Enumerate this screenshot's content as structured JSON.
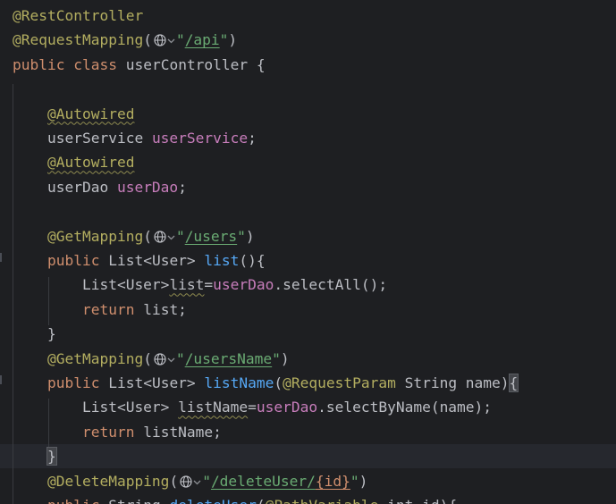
{
  "editor": {
    "lines": [
      {
        "tokens": [
          {
            "t": "@RestController",
            "c": "ann"
          }
        ]
      },
      {
        "tokens": [
          {
            "t": "@RequestMapping",
            "c": "ann"
          },
          {
            "t": "(",
            "c": ""
          },
          {
            "icon": "globe"
          },
          {
            "t": "\"",
            "c": "str"
          },
          {
            "t": "/api",
            "c": "str url"
          },
          {
            "t": "\"",
            "c": "str"
          },
          {
            "t": ")",
            "c": ""
          }
        ]
      },
      {
        "tokens": [
          {
            "t": "public ",
            "c": "kw"
          },
          {
            "t": "class ",
            "c": "kw"
          },
          {
            "t": "userController {",
            "c": ""
          }
        ]
      },
      {
        "tokens": []
      },
      {
        "tokens": [
          {
            "t": "    ",
            "c": ""
          },
          {
            "t": "@Autowired",
            "c": "ann sq"
          }
        ]
      },
      {
        "tokens": [
          {
            "t": "    userService ",
            "c": ""
          },
          {
            "t": "userService",
            "c": "field"
          },
          {
            "t": ";",
            "c": ""
          }
        ]
      },
      {
        "tokens": [
          {
            "t": "    ",
            "c": ""
          },
          {
            "t": "@Autowired",
            "c": "ann sq"
          }
        ]
      },
      {
        "tokens": [
          {
            "t": "    userDao ",
            "c": ""
          },
          {
            "t": "userDao",
            "c": "field"
          },
          {
            "t": ";",
            "c": ""
          }
        ]
      },
      {
        "tokens": []
      },
      {
        "tokens": [
          {
            "t": "    ",
            "c": ""
          },
          {
            "t": "@GetMapping",
            "c": "ann"
          },
          {
            "t": "(",
            "c": ""
          },
          {
            "icon": "globe"
          },
          {
            "t": "\"",
            "c": "str"
          },
          {
            "t": "/users",
            "c": "str url"
          },
          {
            "t": "\"",
            "c": "str"
          },
          {
            "t": ")",
            "c": ""
          }
        ]
      },
      {
        "tokens": [
          {
            "t": "    ",
            "c": ""
          },
          {
            "t": "public ",
            "c": "kw"
          },
          {
            "t": "List<User> ",
            "c": ""
          },
          {
            "t": "list",
            "c": "method"
          },
          {
            "t": "(){",
            "c": ""
          }
        ]
      },
      {
        "tokens": [
          {
            "t": "        List<User>",
            "c": ""
          },
          {
            "t": "list",
            "c": "sq"
          },
          {
            "t": "=",
            "c": ""
          },
          {
            "t": "userDao",
            "c": "field"
          },
          {
            "t": ".selectAll();",
            "c": ""
          }
        ]
      },
      {
        "tokens": [
          {
            "t": "        ",
            "c": ""
          },
          {
            "t": "return ",
            "c": "kw"
          },
          {
            "t": "list;",
            "c": ""
          }
        ]
      },
      {
        "tokens": [
          {
            "t": "    }",
            "c": ""
          }
        ]
      },
      {
        "tokens": [
          {
            "t": "    ",
            "c": ""
          },
          {
            "t": "@GetMapping",
            "c": "ann"
          },
          {
            "t": "(",
            "c": ""
          },
          {
            "icon": "globe"
          },
          {
            "t": "\"",
            "c": "str"
          },
          {
            "t": "/usersName",
            "c": "str url"
          },
          {
            "t": "\"",
            "c": "str"
          },
          {
            "t": ")",
            "c": ""
          }
        ]
      },
      {
        "tokens": [
          {
            "t": "    ",
            "c": ""
          },
          {
            "t": "public ",
            "c": "kw"
          },
          {
            "t": "List<User> ",
            "c": ""
          },
          {
            "t": "listName",
            "c": "method"
          },
          {
            "t": "(",
            "c": ""
          },
          {
            "t": "@RequestParam",
            "c": "ann"
          },
          {
            "t": " String name)",
            "c": ""
          },
          {
            "t": "{",
            "c": "brace-hl"
          }
        ]
      },
      {
        "tokens": [
          {
            "t": "        List<User> ",
            "c": ""
          },
          {
            "t": "listName",
            "c": "sq"
          },
          {
            "t": "=",
            "c": ""
          },
          {
            "t": "userDao",
            "c": "field"
          },
          {
            "t": ".selectByName(name);",
            "c": ""
          }
        ]
      },
      {
        "tokens": [
          {
            "t": "        ",
            "c": ""
          },
          {
            "t": "return ",
            "c": "kw"
          },
          {
            "t": "listName;",
            "c": ""
          }
        ]
      },
      {
        "tokens": [
          {
            "t": "    ",
            "c": ""
          },
          {
            "t": "}",
            "c": "brace-hl"
          }
        ],
        "current": true
      },
      {
        "tokens": [
          {
            "t": "    ",
            "c": ""
          },
          {
            "t": "@DeleteMapping",
            "c": "ann"
          },
          {
            "t": "(",
            "c": ""
          },
          {
            "icon": "globe"
          },
          {
            "t": "\"",
            "c": "str"
          },
          {
            "t": "/deleteUser/",
            "c": "str url"
          },
          {
            "t": "{id}",
            "c": "kw url"
          },
          {
            "t": "\"",
            "c": "str"
          },
          {
            "t": ")",
            "c": ""
          }
        ]
      },
      {
        "tokens": [
          {
            "t": "    ",
            "c": ""
          },
          {
            "t": "public ",
            "c": "kw"
          },
          {
            "t": "String ",
            "c": ""
          },
          {
            "t": "deleteUser",
            "c": "method"
          },
          {
            "t": "(",
            "c": ""
          },
          {
            "t": "@PathVariable",
            "c": "ann"
          },
          {
            "t": " int id){",
            "c": ""
          }
        ]
      }
    ]
  }
}
